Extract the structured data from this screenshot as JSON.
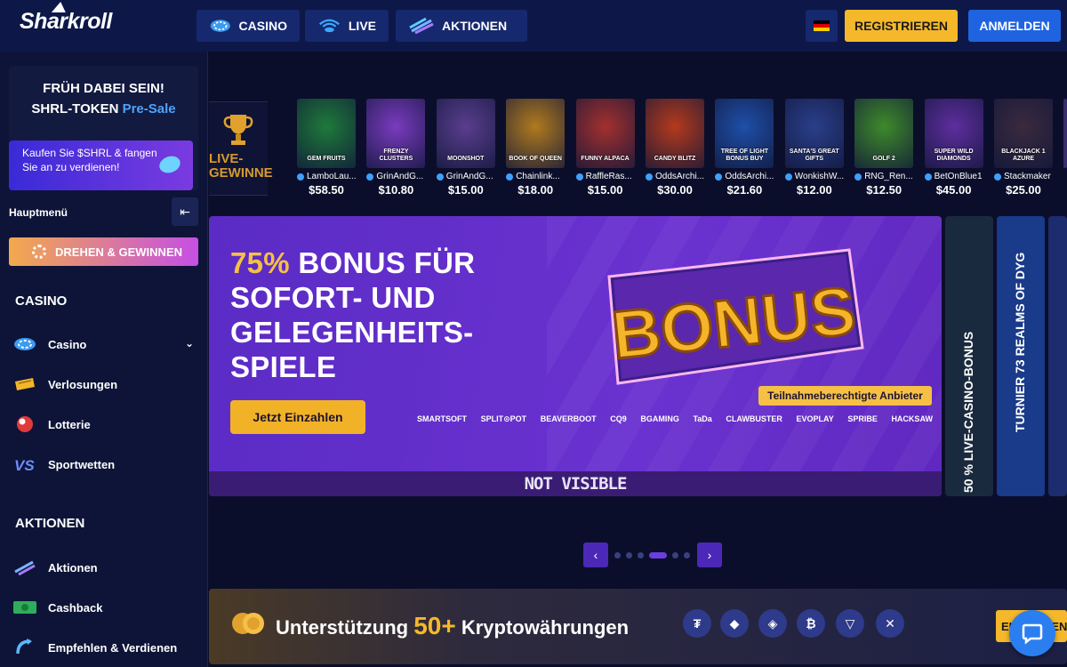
{
  "header": {
    "logo": "Sharkroll",
    "nav": [
      {
        "label": "CASINO",
        "icon": "casino-chip-icon"
      },
      {
        "label": "LIVE",
        "icon": "live-stream-icon"
      },
      {
        "label": "AKTIONEN",
        "icon": "promotions-icon"
      }
    ],
    "language_icon": "german-flag-icon",
    "register_label": "REGISTRIEREN",
    "login_label": "ANMELDEN"
  },
  "sidebar": {
    "promo": {
      "line1": "FRÜH DABEI SEIN!",
      "line2_prefix": "SHRL-TOKEN",
      "line2_highlight": "Pre-Sale",
      "cta": "Kaufen Sie $SHRL & fangen Sie an zu verdienen!"
    },
    "main_menu_label": "Hauptmenü",
    "spin_label": "DREHEN & GEWINNEN",
    "casino_section": "CASINO",
    "casino_items": [
      {
        "label": "Casino",
        "icon": "casino-chip-icon"
      },
      {
        "label": "Verlosungen",
        "icon": "ticket-icon"
      },
      {
        "label": "Lotterie",
        "icon": "lottery-ball-icon"
      },
      {
        "label": "Sportwetten",
        "icon": "vs-icon"
      }
    ],
    "promos_section": "AKTIONEN",
    "promo_items": [
      {
        "label": "Aktionen",
        "icon": "promotions-icon"
      },
      {
        "label": "Cashback",
        "icon": "cashback-icon"
      },
      {
        "label": "Empfehlen & Verdienen",
        "icon": "refer-icon"
      }
    ]
  },
  "live_winners": {
    "label": "LIVE-GEWINNE",
    "games": [
      {
        "name": "GEM FRUITS",
        "user": "LamboLau...",
        "amount": "$58.50",
        "color": "#1e7a3a"
      },
      {
        "name": "FRENZY CLUSTERS",
        "user": "GrinAndG...",
        "amount": "$10.80",
        "color": "#7a3bbf"
      },
      {
        "name": "MOONSHOT",
        "user": "GrinAndG...",
        "amount": "$15.00",
        "color": "#5a3e8e"
      },
      {
        "name": "BOOK OF QUEEN",
        "user": "Chainlink...",
        "amount": "$18.00",
        "color": "#b07a1e"
      },
      {
        "name": "FUNNY ALPACA",
        "user": "RaffleRas...",
        "amount": "$15.00",
        "color": "#a3302e"
      },
      {
        "name": "CANDY BLITZ",
        "user": "OddsArchi...",
        "amount": "$30.00",
        "color": "#b43a1c"
      },
      {
        "name": "TREE OF LIGHT BONUS BUY",
        "user": "OddsArchi...",
        "amount": "$21.60",
        "color": "#1e4fa8"
      },
      {
        "name": "SANTA'S GREAT GIFTS",
        "user": "WonkishW...",
        "amount": "$12.00",
        "color": "#2a3f8a"
      },
      {
        "name": "GOLF 2",
        "user": "RNG_Ren...",
        "amount": "$12.50",
        "color": "#3e8a2a"
      },
      {
        "name": "SUPER WILD DIAMONDS",
        "user": "BetOnBlue1",
        "amount": "$45.00",
        "color": "#5e2e9e"
      },
      {
        "name": "BLACKJACK 1 AZURE",
        "user": "Stackmaker",
        "amount": "$25.00",
        "color": "#3a2a3e"
      }
    ]
  },
  "banner": {
    "title_highlight": "75%",
    "title_rest_line1": " BONUS FÜR",
    "title_line2": "SOFORT- UND",
    "title_line3": "GELEGENHEITS-",
    "title_line4": "SPIELE",
    "cta_label": "Jetzt Einzahlen",
    "art_text": "BONUS",
    "eligible_label": "Teilnahmeberechtigte Anbieter",
    "providers": [
      "SMARTSOFT",
      "SPLIT⊙POT",
      "BEAVERBOOT",
      "CQ9",
      "BGAMING",
      "TaDa",
      "CLAWBUSTER",
      "EVOPLAY",
      "SPRIBE",
      "HACKSAW"
    ],
    "footer_label": "NOT VISIBLE"
  },
  "side_cards": [
    {
      "label": "50 % LIVE-CASINO-BONUS"
    },
    {
      "label": "TURNIER 73 REALMS OF DYG"
    }
  ],
  "pagination": {
    "total": 6,
    "active": 3
  },
  "crypto": {
    "text_prefix": "Unterstützung",
    "count": "50+",
    "text_suffix": "Kryptowährungen",
    "coins": [
      "tether-icon",
      "ethereum-icon",
      "binance-icon",
      "bitcoin-icon",
      "tron-icon",
      "xrp-icon"
    ],
    "cta_label": "EINZAHLEN"
  },
  "colors": {
    "background": "#0b0e2a",
    "header": "#0d1848",
    "accent_yellow": "#f5b82a",
    "accent_blue": "#1f63e0",
    "banner_purple": "#6a32d0"
  }
}
